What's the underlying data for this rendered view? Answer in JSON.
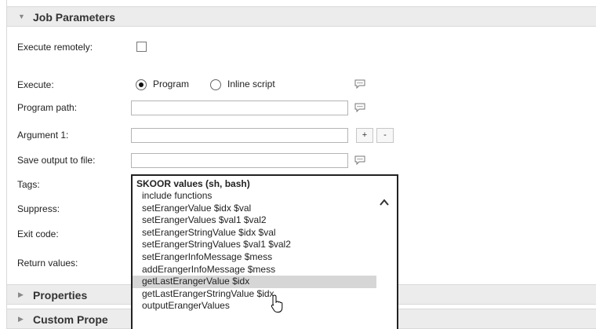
{
  "sections": {
    "job_parameters": "Job Parameters",
    "properties": "Properties",
    "custom_properties": "Custom Prope"
  },
  "fields": {
    "execute_remotely": "Execute remotely:",
    "execute": "Execute:",
    "program_path": "Program path:",
    "argument1": "Argument 1:",
    "save_output": "Save output to file:",
    "tags": "Tags:",
    "suppress": "Suppress:",
    "exit_code": "Exit code:",
    "return_values": "Return values:"
  },
  "execute_options": {
    "program": "Program",
    "inline": "Inline script",
    "selected": "Program"
  },
  "buttons": {
    "add": "+",
    "remove": "-"
  },
  "dropdown": {
    "header": "SKOOR values (sh, bash)",
    "items": [
      "include functions",
      "setErangerValue $idx $val",
      "setErangerValues $val1 $val2",
      "setErangerStringValue $idx $val",
      "setErangerStringValues $val1 $val2",
      "setErangerInfoMessage $mess",
      "addErangerInfoMessage $mess",
      "getLastErangerValue $idx",
      "getLastErangerStringValue $idx",
      "outputErangerValues"
    ],
    "hover_index": 7
  },
  "icons": {
    "section_expanded": "triangle-down-icon",
    "section_collapsed": "triangle-right-icon",
    "comment": "comment-icon",
    "scroll_up": "chevron-up-icon",
    "cursor": "mouse-pointer-icon"
  },
  "colors": {
    "header_bg": "#ececec",
    "hover_bg": "#d6d6d6",
    "border_dark": "#222222"
  }
}
